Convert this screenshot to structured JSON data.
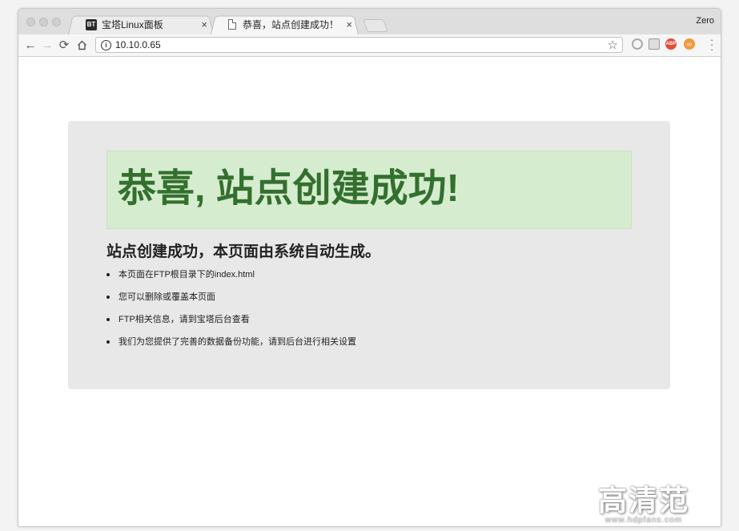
{
  "browser": {
    "profile_name": "Zero",
    "tabs": [
      {
        "title": "宝塔Linux面板",
        "favicon": "BT",
        "active": false
      },
      {
        "title": "恭喜，站点创建成功！",
        "favicon": "document-icon",
        "active": true
      }
    ],
    "tab_close_glyph": "×",
    "address_bar": {
      "url": "10.10.0.65"
    }
  },
  "page": {
    "headline": "恭喜, 站点创建成功!",
    "subtitle": "站点创建成功，本页面由系统自动生成。",
    "items": [
      "本页面在FTP根目录下的index.html",
      "您可以删除或覆盖本页面",
      "FTP相关信息，请到宝塔后台查看",
      "我们为您提供了完善的数据备份功能，请到后台进行相关设置"
    ],
    "colors": {
      "alert_bg": "#d6eccf",
      "headline": "#33702e",
      "container_bg": "#e8e8e8"
    }
  },
  "watermark": {
    "logo": "高清范",
    "url": "www.hdpfans.com"
  },
  "extensions": [
    {
      "name": "circle-extension-icon",
      "badge": ""
    },
    {
      "name": "grey-extension-icon",
      "badge": ""
    },
    {
      "name": "abp-extension-icon",
      "badge": "ABP"
    },
    {
      "name": "orange-extension-icon",
      "badge": "∞"
    }
  ]
}
